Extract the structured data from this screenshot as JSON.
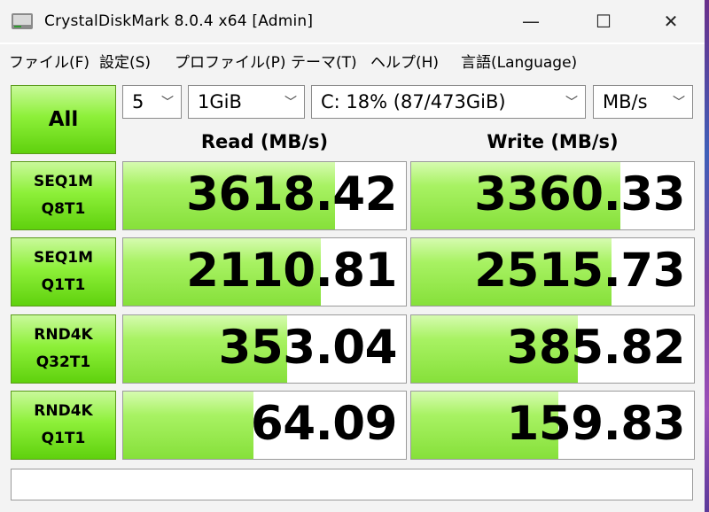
{
  "window": {
    "title": "CrystalDiskMark 8.0.4 x64 [Admin]",
    "controls": {
      "minimize": "—",
      "maximize": "☐",
      "close": "✕"
    }
  },
  "menu": {
    "items": [
      "ファイル(F)",
      "設定(S)",
      "プロファイル(P)",
      "テーマ(T)",
      "ヘルプ(H)",
      "言語(Language)"
    ]
  },
  "toolbar": {
    "all_label": "All",
    "count": "5",
    "size": "1GiB",
    "drive": "C: 18% (87/473GiB)",
    "unit": "MB/s"
  },
  "headers": {
    "read": "Read (MB/s)",
    "write": "Write (MB/s)"
  },
  "tests": [
    {
      "line1": "SEQ1M",
      "line2": "Q8T1",
      "read": "3618.42",
      "write": "3360.33",
      "read_fill": 0.75,
      "write_fill": 0.74
    },
    {
      "line1": "SEQ1M",
      "line2": "Q1T1",
      "read": "2110.81",
      "write": "2515.73",
      "read_fill": 0.7,
      "write_fill": 0.71
    },
    {
      "line1": "RND4K",
      "line2": "Q32T1",
      "read": "353.04",
      "write": "385.82",
      "read_fill": 0.58,
      "write_fill": 0.59
    },
    {
      "line1": "RND4K",
      "line2": "Q1T1",
      "read": "64.09",
      "write": "159.83",
      "read_fill": 0.46,
      "write_fill": 0.52
    }
  ],
  "status": ""
}
